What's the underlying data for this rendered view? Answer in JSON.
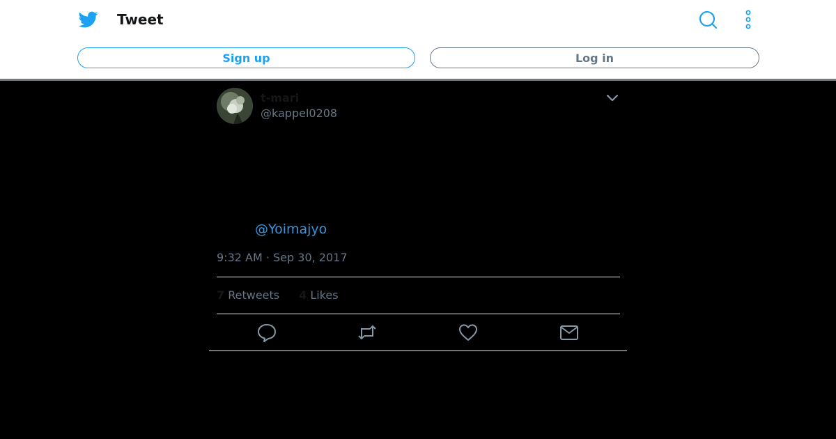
{
  "header": {
    "title": "Tweet",
    "signup_label": "Sign up",
    "login_label": "Log in",
    "icons": {
      "logo": "twitter-bird-icon",
      "search": "search-icon",
      "more": "more-vertical-icon"
    },
    "accent_color": "#1da1f2"
  },
  "tweet": {
    "display_name": "t-mari",
    "handle": "@kappel0208",
    "mention": "@Yoimajyo",
    "timestamp": "9:32 AM · Sep 30, 2017",
    "retweet_count": "7",
    "retweet_label": "Retweets",
    "like_count": "4",
    "like_label": "Likes",
    "actions": [
      "reply-icon",
      "retweet-icon",
      "like-icon",
      "direct-message-icon"
    ]
  }
}
